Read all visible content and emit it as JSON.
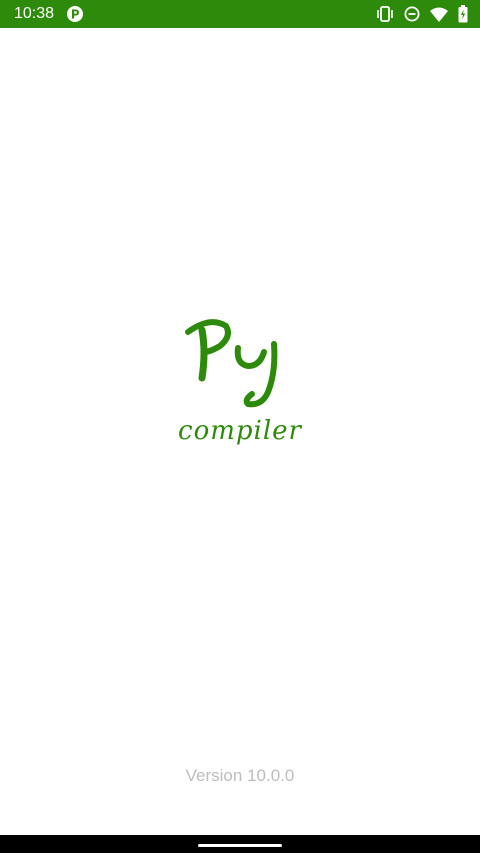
{
  "status_bar": {
    "time": "10:38",
    "background": "#2e8a0a",
    "icons": [
      "app-notification-icon",
      "vibrate-icon",
      "do-not-disturb-icon",
      "wifi-icon",
      "battery-icon"
    ]
  },
  "logo": {
    "mark_text": "Py",
    "word_text": "compiler",
    "color": "#2e8a0a"
  },
  "footer": {
    "version": "Version 10.0.0"
  }
}
